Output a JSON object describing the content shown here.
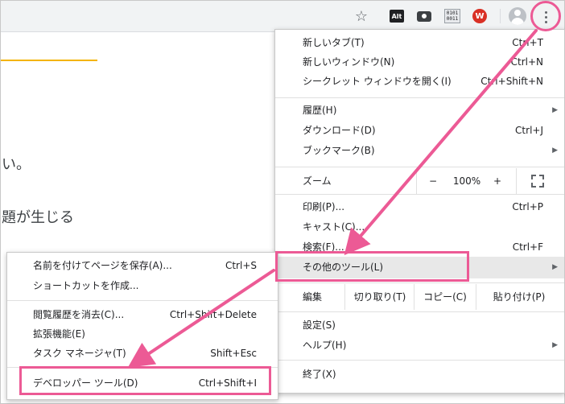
{
  "toolbar": {
    "star_icon": "☆",
    "ext_alt_text": "Alt",
    "ext_bin_line1": "0101",
    "ext_bin_line2": "0011",
    "ext_wp_text": "W"
  },
  "page": {
    "line1": "い。",
    "line2": "題が生じる"
  },
  "main_menu": {
    "items_top": [
      {
        "label": "新しいタブ(T)",
        "shortcut": "Ctrl+T"
      },
      {
        "label": "新しいウィンドウ(N)",
        "shortcut": "Ctrl+N"
      },
      {
        "label": "シークレット ウィンドウを開く(I)",
        "shortcut": "Ctrl+Shift+N"
      }
    ],
    "items_history": [
      {
        "label": "履歴(H)",
        "shortcut": ""
      },
      {
        "label": "ダウンロード(D)",
        "shortcut": "Ctrl+J"
      },
      {
        "label": "ブックマーク(B)",
        "shortcut": ""
      }
    ],
    "zoom": {
      "label": "ズーム",
      "minus": "−",
      "value": "100%",
      "plus": "+"
    },
    "items_print": [
      {
        "label": "印刷(P)...",
        "shortcut": "Ctrl+P"
      },
      {
        "label": "キャスト(C)...",
        "shortcut": ""
      },
      {
        "label": "検索(F)...",
        "shortcut": "Ctrl+F"
      },
      {
        "label": "その他のツール(L)",
        "shortcut": ""
      }
    ],
    "edit": {
      "label": "編集",
      "cut": "切り取り(T)",
      "copy": "コピー(C)",
      "paste": "貼り付け(P)"
    },
    "items_settings": [
      {
        "label": "設定(S)",
        "shortcut": ""
      },
      {
        "label": "ヘルプ(H)",
        "shortcut": ""
      }
    ],
    "exit": {
      "label": "終了(X)"
    },
    "arrow": "▶"
  },
  "sub_menu": {
    "items": [
      {
        "label": "名前を付けてページを保存(A)...",
        "shortcut": "Ctrl+S"
      },
      {
        "label": "ショートカットを作成...",
        "shortcut": ""
      },
      {
        "label": "閲覧履歴を消去(C)...",
        "shortcut": "Ctrl+Shift+Delete"
      },
      {
        "label": "拡張機能(E)",
        "shortcut": ""
      },
      {
        "label": "タスク マネージャ(T)",
        "shortcut": "Shift+Esc"
      },
      {
        "label": "デベロッパー ツール(D)",
        "shortcut": "Ctrl+Shift+I"
      }
    ]
  },
  "colors": {
    "highlight": "#ec5a95",
    "accent_line": "#f4b400"
  }
}
